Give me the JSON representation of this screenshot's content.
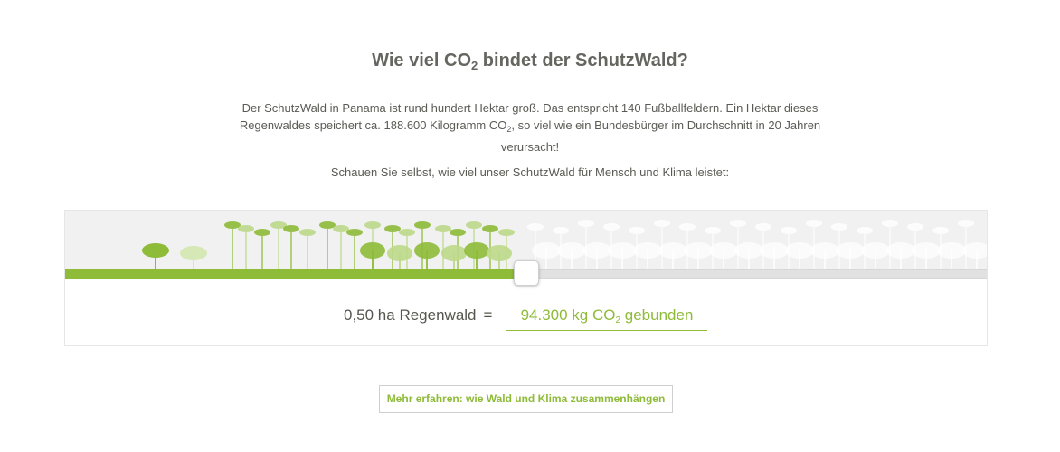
{
  "heading": {
    "prefix": "Wie viel CO",
    "sub": "2",
    "suffix": " bindet der SchutzWald?"
  },
  "intro": {
    "p1_before": "Der SchutzWald in Panama ist rund hundert Hektar groß. Das entspricht 140 Fußballfeldern. Ein Hektar dieses Regenwaldes speichert ca. 188.600 Kilogramm CO",
    "p1_sub": "2",
    "p1_after": ", so viel wie ein Bundesbürger im Durchschnitt in 20 Jahren verursacht!",
    "p2": "Schauen Sie selbst, wie viel unser SchutzWald für Mensch und Klima leistet:"
  },
  "slider": {
    "value_fraction": 0.5,
    "colors": {
      "fill": "#8ebb38",
      "track": "#e1e1e1"
    }
  },
  "result": {
    "area": "0,50 ha Regenwald",
    "equals": "=",
    "amount_prefix": "94.300 kg CO",
    "amount_sub": "2",
    "amount_suffix": " gebunden"
  },
  "more_button": {
    "label": "Mehr erfahren: wie Wald und Klima zusammenhängen"
  },
  "colors": {
    "accent": "#8ebb38",
    "text": "#5a5a52"
  }
}
